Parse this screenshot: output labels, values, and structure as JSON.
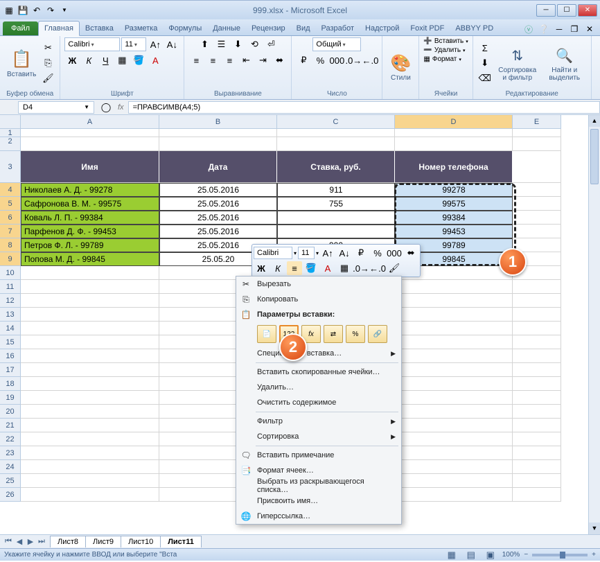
{
  "title": "999.xlsx - Microsoft Excel",
  "tabs": {
    "file": "Файл",
    "items": [
      "Главная",
      "Вставка",
      "Разметка",
      "Формулы",
      "Данные",
      "Рецензир",
      "Вид",
      "Разработ",
      "Надстрой",
      "Foxit PDF",
      "ABBYY PD"
    ],
    "active": 0
  },
  "ribbon": {
    "clipboard": {
      "label": "Буфер обмена",
      "paste": "Вставить"
    },
    "font": {
      "label": "Шрифт",
      "family": "Calibri",
      "size": "11"
    },
    "align": {
      "label": "Выравнивание"
    },
    "number": {
      "label": "Число",
      "format": "Общий"
    },
    "styles": {
      "label": "Стили",
      "btn": "Стили"
    },
    "cells": {
      "label": "Ячейки",
      "insert": "Вставить",
      "delete": "Удалить",
      "format": "Формат"
    },
    "editing": {
      "label": "Редактирование",
      "sort": "Сортировка и фильтр",
      "find": "Найти и выделить"
    }
  },
  "formulabar": {
    "cell": "D4",
    "formula": "=ПРАВСИМВ(A4;5)"
  },
  "cols": [
    "A",
    "B",
    "C",
    "D",
    "E"
  ],
  "headers": {
    "A": "Имя",
    "B": "Дата",
    "C": "Ставка, руб.",
    "D": "Номер телефона"
  },
  "rows": [
    {
      "n": "4",
      "A": "Николаев А. Д. - 99278",
      "B": "25.05.2016",
      "C": "911",
      "D": "99278"
    },
    {
      "n": "5",
      "A": "Сафронова В. М. - 99575",
      "B": "25.05.2016",
      "C": "755",
      "D": "99575"
    },
    {
      "n": "6",
      "A": "Коваль Л. П. - 99384",
      "B": "25.05.2016",
      "C": "",
      "D": "99384"
    },
    {
      "n": "7",
      "A": "Парфенов Д. Ф. - 99453",
      "B": "25.05.2016",
      "C": "",
      "D": "99453"
    },
    {
      "n": "8",
      "A": "Петров Ф. Л. - 99789",
      "B": "25.05.2016",
      "C": "900",
      "D": "99789"
    },
    {
      "n": "9",
      "A": "Попова М. Д. - 99845",
      "B": "25.05.20",
      "C": "",
      "D": "99845"
    }
  ],
  "emptyrows": [
    "10",
    "11",
    "12",
    "13",
    "14",
    "15",
    "16",
    "17",
    "18",
    "19",
    "20",
    "21",
    "22",
    "23",
    "24",
    "25",
    "26"
  ],
  "minitoolbar": {
    "font": "Calibri",
    "size": "11"
  },
  "ctx": {
    "cut": "Вырезать",
    "copy": "Копировать",
    "paste_label": "Параметры вставки:",
    "special": "Специальная вставка…",
    "insert_copied": "Вставить скопированные ячейки…",
    "delete": "Удалить…",
    "clear": "Очистить содержимое",
    "filter": "Фильтр",
    "sort": "Сортировка",
    "comment": "Вставить примечание",
    "format": "Формат ячеек…",
    "dropdown": "Выбрать из раскрывающегося списка…",
    "name": "Присвоить имя…",
    "hyperlink": "Гиперссылка…"
  },
  "sheets": [
    "Лист8",
    "Лист9",
    "Лист10",
    "Лист11"
  ],
  "status": {
    "text": "Укажите ячейку и нажмите ВВОД или выберите \"Вста",
    "zoom": "100%"
  },
  "callouts": {
    "one": "1",
    "two": "2"
  }
}
